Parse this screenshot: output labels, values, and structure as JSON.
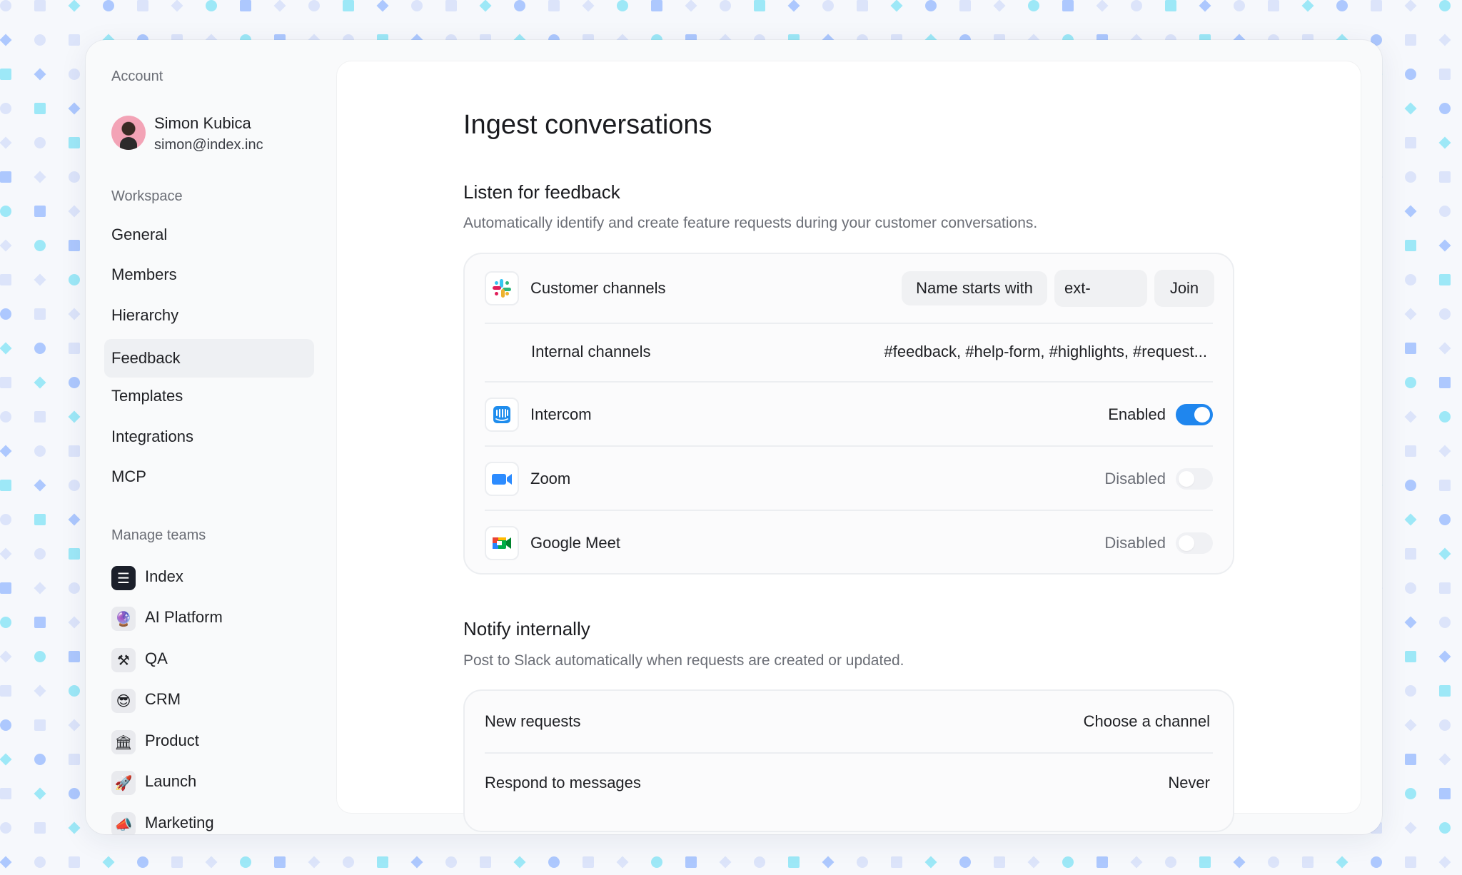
{
  "sidebar": {
    "account_label": "Account",
    "user": {
      "name": "Simon Kubica",
      "email": "simon@index.inc"
    },
    "workspace_label": "Workspace",
    "nav": [
      {
        "label": "General"
      },
      {
        "label": "Members"
      },
      {
        "label": "Hierarchy"
      },
      {
        "label": "Feedback",
        "active": true
      },
      {
        "label": "Templates"
      },
      {
        "label": "Integrations"
      },
      {
        "label": "MCP"
      }
    ],
    "teams_label": "Manage teams",
    "teams": [
      {
        "label": "Index",
        "icon": "index-logo-icon",
        "glyph": "☰"
      },
      {
        "label": "AI Platform",
        "icon": "crystal-ball-icon",
        "glyph": "🔮"
      },
      {
        "label": "QA",
        "icon": "tools-icon",
        "glyph": "⚒"
      },
      {
        "label": "CRM",
        "icon": "sunglasses-face-icon",
        "glyph": "😎"
      },
      {
        "label": "Product",
        "icon": "building-icon",
        "glyph": "🏛"
      },
      {
        "label": "Launch",
        "icon": "rocket-icon",
        "glyph": "🚀"
      },
      {
        "label": "Marketing",
        "icon": "megaphone-icon",
        "glyph": "📣"
      }
    ]
  },
  "main": {
    "title": "Ingest conversations",
    "listen": {
      "title": "Listen for feedback",
      "description": "Automatically identify and create feature requests during your customer conversations.",
      "customer_channels": {
        "label": "Customer channels",
        "icon": "slack-icon",
        "filter_label": "Name starts with",
        "prefix_value": "ext-",
        "join_label": "Join"
      },
      "internal_channels": {
        "label": "Internal channels",
        "value": "#feedback, #help-form, #highlights, #request..."
      },
      "integrations": [
        {
          "label": "Intercom",
          "icon": "intercom-icon",
          "status": "Enabled",
          "enabled": true
        },
        {
          "label": "Zoom",
          "icon": "zoom-icon",
          "status": "Disabled",
          "enabled": false
        },
        {
          "label": "Google Meet",
          "icon": "google-meet-icon",
          "status": "Disabled",
          "enabled": false
        }
      ]
    },
    "notify": {
      "title": "Notify internally",
      "description": "Post to Slack automatically when requests are created or updated.",
      "rows": [
        {
          "label": "New requests",
          "value": "Choose a channel"
        },
        {
          "label": "Respond to messages",
          "value": "Never"
        }
      ]
    }
  },
  "colors": {
    "accent": "#1f86ee",
    "pattern_blue": "#94b8ff",
    "pattern_cyan": "#7fe3f5",
    "pattern_light": "#d3def9"
  }
}
